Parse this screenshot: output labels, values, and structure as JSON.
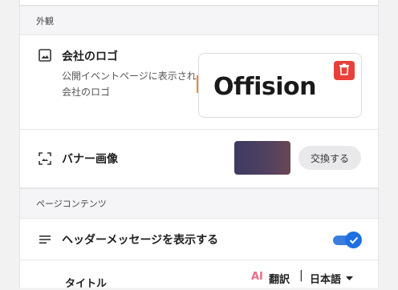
{
  "sections": {
    "appearance": "外観",
    "page_contents": "ページコンテンツ"
  },
  "logo_row": {
    "icon": "image-icon",
    "title": "会社のロゴ",
    "description": "公開イベントページに表示される会社のロゴ",
    "logo_text": "Offision",
    "delete_icon": "trash-icon"
  },
  "banner_row": {
    "icon": "image-crop-icon",
    "title": "バナー画像",
    "replace_label": "交換する"
  },
  "header_message_row": {
    "icon": "text-lines-icon",
    "title": "ヘッダーメッセージを表示する",
    "enabled": true
  },
  "title_row": {
    "title": "タイトル",
    "ai_label": "AI",
    "translate_label": "翻訳",
    "separator": "|",
    "language": "日本語"
  },
  "colors": {
    "accent": "#1e6fe0",
    "delete": "#e8403a",
    "ai": "#f06a86"
  }
}
